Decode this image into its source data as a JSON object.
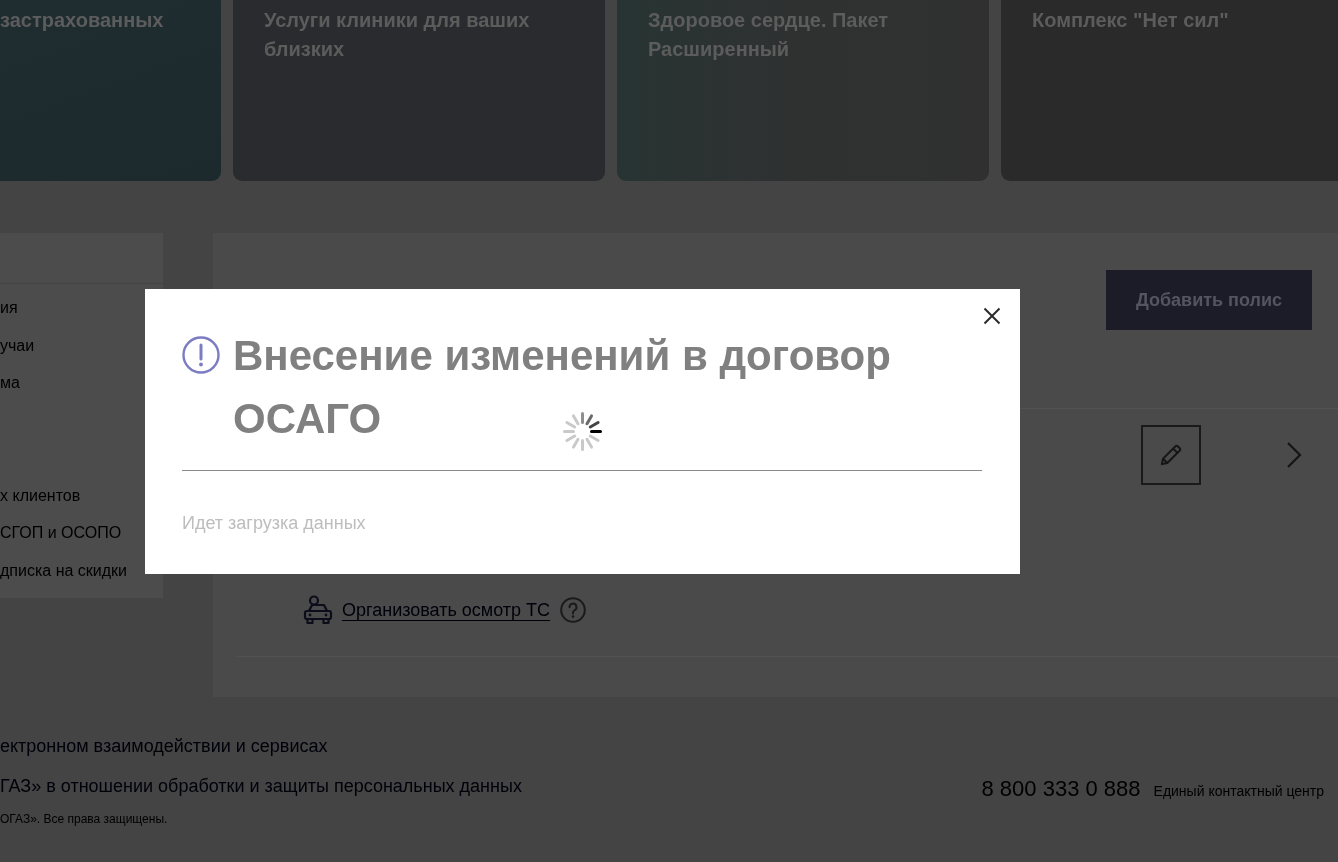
{
  "promo_cards": [
    {
      "title": "застрахованных"
    },
    {
      "title": "Услуги клиники для ваших близких"
    },
    {
      "title": "Здоровое сердце. Пакет Расширенный"
    },
    {
      "title": "Комплекс \"Нет сил\""
    }
  ],
  "sidebar": {
    "groups": [
      {
        "items": [
          "ия",
          "учаи",
          "ма"
        ]
      },
      {
        "items": [
          "х клиентов",
          "СГОП и ОСОПО",
          "дписка на скидки"
        ]
      }
    ]
  },
  "policies": {
    "add_button": "Добавить полис",
    "inspection_link": "Организовать осмотр ТС"
  },
  "footer": {
    "links": [
      "ектронном взаимодействии и сервисах",
      "ГАЗ» в отношении обработки и защиты персональных данных"
    ],
    "copyright": "ОГАЗ». Все права защищены.",
    "phone": "8 800 333 0 888",
    "phone_caption": "Единый контактный центр"
  },
  "modal": {
    "title": "Внесение изменений в договор ОСАГО",
    "loading": true,
    "message": "Идет загрузка данных"
  }
}
